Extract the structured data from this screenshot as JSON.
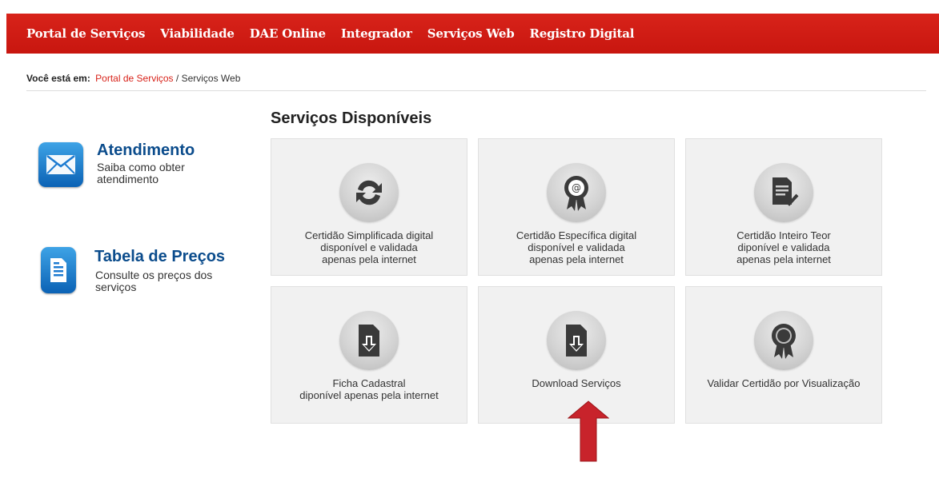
{
  "nav": {
    "items": [
      {
        "label": "Portal de Serviços"
      },
      {
        "label": "Viabilidade"
      },
      {
        "label": "DAE Online"
      },
      {
        "label": "Integrador"
      },
      {
        "label": "Serviços Web"
      },
      {
        "label": "Registro Digital"
      }
    ]
  },
  "breadcrumb": {
    "prefix": "Você está em:",
    "link": "Portal de Serviços",
    "current": "/ Serviços Web"
  },
  "side": {
    "atendimento": {
      "title": "Atendimento",
      "desc": "Saiba como obter atendimento"
    },
    "tabela": {
      "title": "Tabela de Preços",
      "desc": "Consulte os preços dos serviços"
    }
  },
  "main": {
    "title": "Serviços Disponíveis",
    "cards": [
      {
        "icon": "sync-arrows-icon",
        "lines": [
          "Certidão Simplificada digital",
          "disponível e validada",
          "apenas pela internet"
        ]
      },
      {
        "icon": "certificate-seal-icon",
        "lines": [
          "Certidão Específica digital",
          "disponível e validada",
          "apenas pela internet"
        ]
      },
      {
        "icon": "document-check-icon",
        "lines": [
          "Certidão Inteiro Teor",
          "diponível e validada",
          "apenas pela internet"
        ]
      },
      {
        "icon": "file-download-icon",
        "lines": [
          "Ficha Cadastral",
          "diponível apenas pela internet",
          ""
        ]
      },
      {
        "icon": "file-download-icon",
        "lines": [
          "Download Serviços",
          "",
          ""
        ]
      },
      {
        "icon": "award-badge-icon",
        "lines": [
          "Validar Certidão por Visualização",
          "",
          ""
        ]
      }
    ]
  },
  "annotation": {
    "icon": "red-up-arrow-icon"
  },
  "colors": {
    "brand_red": "#d8231a",
    "link_blue": "#0b4c8c",
    "card_bg": "#f1f1f1",
    "icon_dark": "#3a3a3a"
  }
}
